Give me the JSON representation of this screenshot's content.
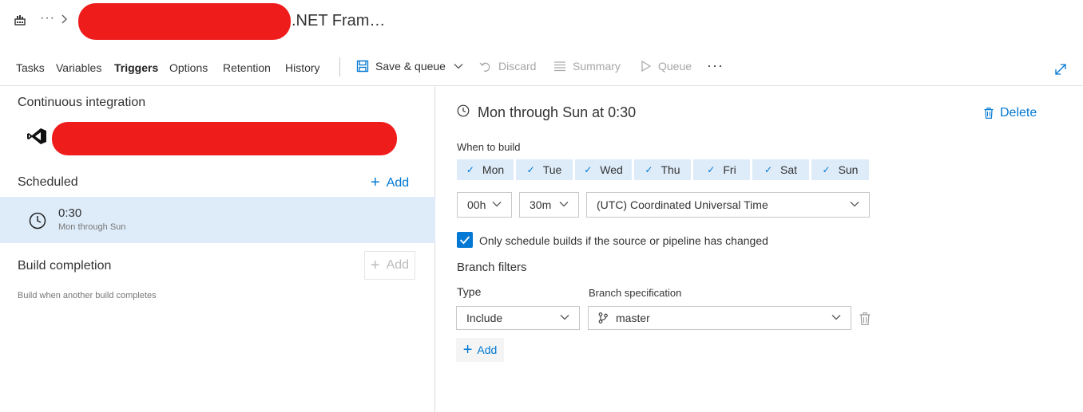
{
  "header": {
    "breadcrumb_ellipsis": "···",
    "title": ".NET Fram…"
  },
  "toolbar": {
    "tabs": [
      {
        "label": "Tasks"
      },
      {
        "label": "Variables"
      },
      {
        "label": "Triggers",
        "active": true
      },
      {
        "label": "Options"
      },
      {
        "label": "Retention"
      },
      {
        "label": "History"
      }
    ],
    "save_queue_label": "Save & queue",
    "discard_label": "Discard",
    "summary_label": "Summary",
    "queue_label": "Queue",
    "more_label": "···"
  },
  "left": {
    "continuous_integration_title": "Continuous integration",
    "scheduled_title": "Scheduled",
    "scheduled_add_label": "Add",
    "schedule_item": {
      "time": "0:30",
      "days": "Mon through Sun"
    },
    "build_completion_title": "Build completion",
    "build_completion_add_label": "Add",
    "build_completion_subtitle": "Build when another build completes"
  },
  "right": {
    "heading": "Mon through Sun at 0:30",
    "delete_label": "Delete",
    "when_to_build_label": "When to build",
    "days": [
      "Mon",
      "Tue",
      "Wed",
      "Thu",
      "Fri",
      "Sat",
      "Sun"
    ],
    "hour_value": "00h",
    "minute_value": "30m",
    "timezone_value": "(UTC) Coordinated Universal Time",
    "only_changed_label": "Only schedule builds if the source or pipeline has changed",
    "only_changed_checked": true,
    "branch_filters_title": "Branch filters",
    "type_label": "Type",
    "type_value": "Include",
    "branch_spec_label": "Branch specification",
    "branch_value": "master",
    "add_label": "Add"
  },
  "colors": {
    "accent": "#0078d4",
    "selected_bg": "#deecf9",
    "redaction": "#ef1c1c",
    "disabled_text": "#a6a6a6"
  }
}
